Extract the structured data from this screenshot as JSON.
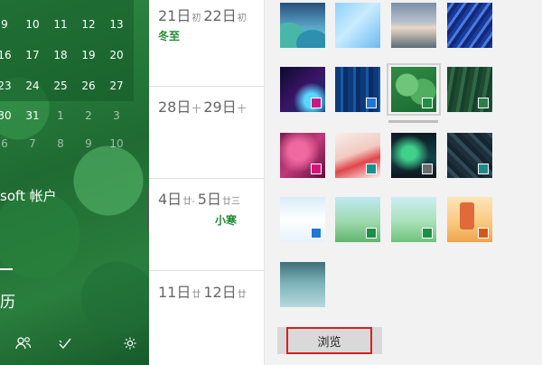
{
  "mini_calendar": {
    "rows": [
      [
        "9",
        "10",
        "11",
        "12",
        "13"
      ],
      [
        "16",
        "17",
        "18",
        "19",
        "20"
      ],
      [
        "23",
        "24",
        "25",
        "26",
        "27"
      ],
      [
        "30",
        "31",
        "1",
        "2",
        "3"
      ],
      [
        "6",
        "7",
        "8",
        "9",
        "10"
      ]
    ]
  },
  "account_label": "soft 帐户",
  "left_text": "历",
  "calendar_rows": [
    {
      "d1": "21日",
      "s1": "初",
      "d2": "22日",
      "s2": "初",
      "term": "冬至"
    },
    {
      "d1": "28日",
      "s1": "十",
      "d2": "29日",
      "s2": "十",
      "term": ""
    },
    {
      "d1": "4日",
      "s1": "廿-",
      "d2": "5日",
      "s2": "廿三",
      "term": "小寒"
    },
    {
      "d1": "11日",
      "s1": "廿",
      "d2": "12日",
      "s2": "廿",
      "term": ""
    }
  ],
  "browse_label": "浏览",
  "accent_colors": [
    "#c41a8a",
    "#1f78d1",
    "#1e8f46",
    "#2d7f48",
    "#d4147a",
    "#1d8f8c",
    "#6b6b6b",
    "#1a8a8a",
    "#1f78d1",
    "#1e8f46",
    "#1e8f46",
    "#d4581a"
  ]
}
